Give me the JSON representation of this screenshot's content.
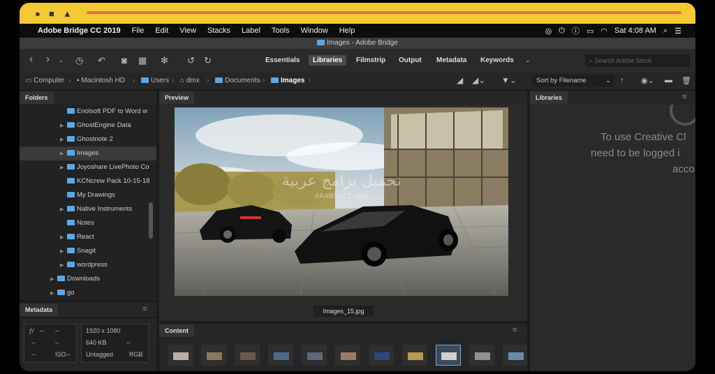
{
  "menubar": {
    "app_name": "Adobe Bridge CC 2019",
    "items": [
      "File",
      "Edit",
      "View",
      "Stacks",
      "Label",
      "Tools",
      "Window",
      "Help"
    ],
    "clock": "Sat 4:08 AM"
  },
  "window": {
    "title": "Images - Adobe Bridge"
  },
  "workspaces": [
    "Essentials",
    "Libraries",
    "Filmstrip",
    "Output",
    "Metadata",
    "Keywords"
  ],
  "active_workspace": "Libraries",
  "search": {
    "placeholder": "Search Adobe Stock"
  },
  "breadcrumb": [
    "Computer",
    "Macintosh HD",
    "Users",
    "dmx",
    "Documents",
    "Images"
  ],
  "sort": {
    "label": "Sort by Filename"
  },
  "panels": {
    "folders": "Folders",
    "preview": "Preview",
    "libraries": "Libraries",
    "metadata": "Metadata",
    "content": "Content"
  },
  "folders": [
    {
      "name": "Enolsoft PDF to Word w",
      "expandable": false
    },
    {
      "name": "GhostEngine Data",
      "expandable": true
    },
    {
      "name": "Ghostnote 2",
      "expandable": true
    },
    {
      "name": "Images",
      "expandable": true,
      "selected": true
    },
    {
      "name": "Joyoshare LivePhoto Co",
      "expandable": true
    },
    {
      "name": "KCNcrew Pack 10-15-18",
      "expandable": false
    },
    {
      "name": "My Drawings",
      "expandable": false
    },
    {
      "name": "Native Instruments",
      "expandable": true
    },
    {
      "name": "Notes",
      "expandable": false
    },
    {
      "name": "React",
      "expandable": true
    },
    {
      "name": "Snagit",
      "expandable": true
    },
    {
      "name": "wordpress",
      "expandable": true
    },
    {
      "name": "Downloads",
      "expandable": true
    },
    {
      "name": "go",
      "expandable": true
    }
  ],
  "metadata": {
    "fstop": "--",
    "shutter": "--",
    "exposure1": "--",
    "exposure2": "--",
    "iso_label": "ISO",
    "iso": "--",
    "dimensions": "1920 x 1080",
    "size": "640 KB",
    "size_extra": "--",
    "profile": "Untagged",
    "mode": "RGB"
  },
  "preview": {
    "filename": "Images_15.jpg"
  },
  "libraries": {
    "message_lines": [
      "To use Creative Cl",
      "need to be logged i",
      "acco"
    ]
  },
  "watermark": {
    "arabic": "تحميل برامج عربية",
    "latin": "ARABSOFT.ORG"
  },
  "thumbnails": 11,
  "selected_thumbnail": 8
}
